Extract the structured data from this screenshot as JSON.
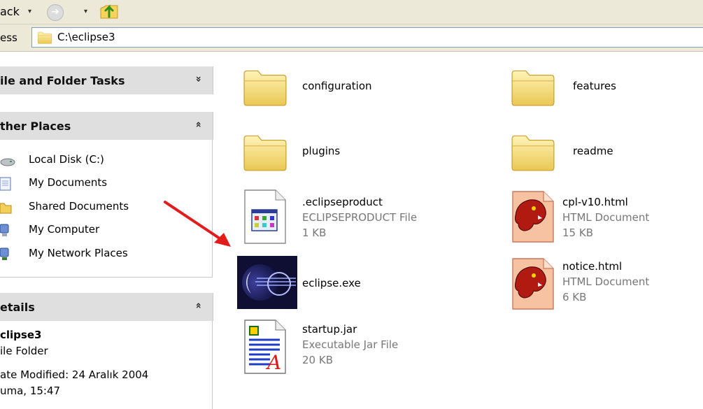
{
  "toolbar": {
    "back_label": "ack",
    "back_caret": "▾",
    "forward_caret": "▾",
    "forward_arrow": "➔"
  },
  "address": {
    "label": "ess",
    "path": "C:\\eclipse3"
  },
  "sidebar": {
    "file_folder_tasks": {
      "title": "ile and Folder Tasks",
      "chevron": "»"
    },
    "other_places": {
      "title": "ther Places",
      "chevron": "«",
      "items": [
        {
          "label": "Local Disk (C:)",
          "icon": "hard-drive-icon"
        },
        {
          "label": "My Documents",
          "icon": "documents-icon"
        },
        {
          "label": "Shared Documents",
          "icon": "folder-icon"
        },
        {
          "label": "My Computer",
          "icon": "computer-icon"
        },
        {
          "label": "My Network Places",
          "icon": "network-icon"
        }
      ]
    },
    "details": {
      "title": "etails",
      "chevron": "«",
      "name": "clipse3",
      "type": "ile Folder",
      "modified_line1": "ate Modified: 24 Aralık 2004",
      "modified_line2": "uma, 15:47"
    }
  },
  "files": [
    {
      "name": "configuration",
      "icon": "folder-icon"
    },
    {
      "name": "features",
      "icon": "folder-icon"
    },
    {
      "name": "plugins",
      "icon": "folder-icon"
    },
    {
      "name": "readme",
      "icon": "folder-icon"
    },
    {
      "name": ".eclipseproduct",
      "type": "ECLIPSEPRODUCT File",
      "size": "1 KB",
      "icon": "generic-file-icon"
    },
    {
      "name": "cpl-v10.html",
      "type": "HTML Document",
      "size": "15 KB",
      "icon": "mozilla-html-icon"
    },
    {
      "name": "eclipse.exe",
      "icon": "eclipse-icon"
    },
    {
      "name": "notice.html",
      "type": "HTML Document",
      "size": "6 KB",
      "icon": "mozilla-html-icon"
    },
    {
      "name": "startup.jar",
      "type": "Executable Jar File",
      "size": "20 KB",
      "icon": "jar-file-icon"
    }
  ],
  "colors": {
    "toolbar_bg": "#ece9d8",
    "panel_header_bg": "#dfdfdf",
    "folder_fill": "#f6dc7e",
    "arrow": "#e21b1b",
    "secondary_text": "#777777"
  }
}
